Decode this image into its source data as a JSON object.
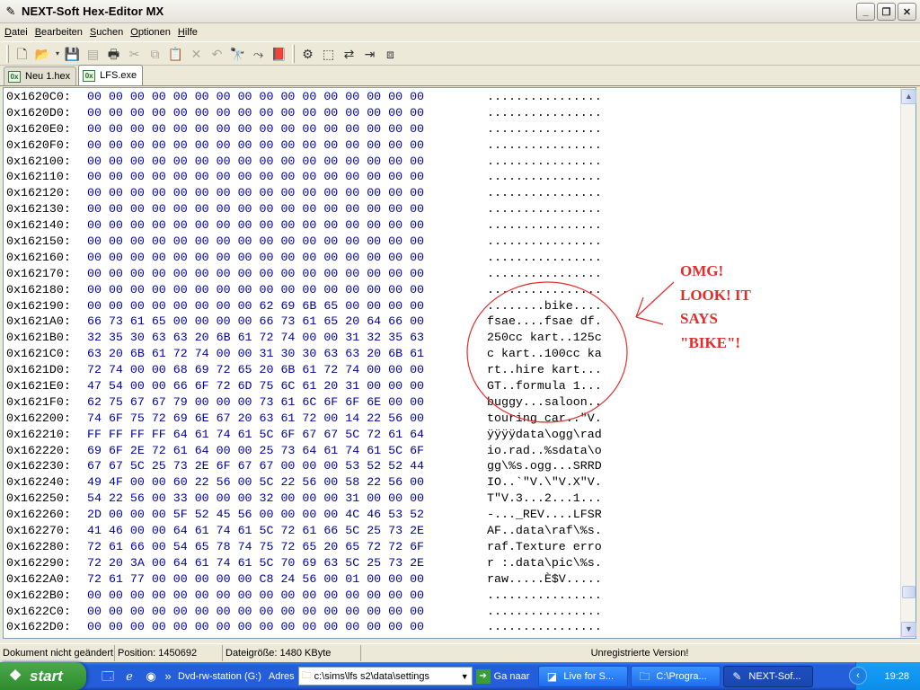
{
  "window": {
    "title": "NEXT-Soft Hex-Editor MX",
    "min_icon": "minimize-icon",
    "max_icon": "restore-icon",
    "close_icon": "close-icon"
  },
  "menu": [
    {
      "label": "Datei",
      "key": "D",
      "rest": "atei"
    },
    {
      "label": "Bearbeiten",
      "key": "B",
      "rest": "earbeiten"
    },
    {
      "label": "Suchen",
      "key": "S",
      "rest": "uchen"
    },
    {
      "label": "Optionen",
      "key": "O",
      "rest": "ptionen"
    },
    {
      "label": "Hilfe",
      "key": "H",
      "rest": "ilfe"
    }
  ],
  "toolbar": {
    "icons": [
      "new-file-icon",
      "open-folder-icon",
      "dropdown-arrow-icon",
      "save-icon",
      "save-all-icon",
      "print-icon",
      "cut-icon",
      "copy-icon",
      "paste-icon",
      "delete-icon",
      "undo-icon",
      "find-icon",
      "find-next-icon",
      "book-icon",
      "settings-icon",
      "select-icon",
      "replace-icon",
      "goto-icon",
      "compare-icon"
    ]
  },
  "tabs": [
    {
      "label": "Neu 1.hex",
      "active": false
    },
    {
      "label": "LFS.exe",
      "active": true
    }
  ],
  "rows": [
    {
      "addr": "0x1620C0:",
      "hex": "00 00 00 00 00 00 00 00 00 00 00 00 00 00 00 00",
      "ascii": "................"
    },
    {
      "addr": "0x1620D0:",
      "hex": "00 00 00 00 00 00 00 00 00 00 00 00 00 00 00 00",
      "ascii": "................"
    },
    {
      "addr": "0x1620E0:",
      "hex": "00 00 00 00 00 00 00 00 00 00 00 00 00 00 00 00",
      "ascii": "................"
    },
    {
      "addr": "0x1620F0:",
      "hex": "00 00 00 00 00 00 00 00 00 00 00 00 00 00 00 00",
      "ascii": "................"
    },
    {
      "addr": "0x162100:",
      "hex": "00 00 00 00 00 00 00 00 00 00 00 00 00 00 00 00",
      "ascii": "................"
    },
    {
      "addr": "0x162110:",
      "hex": "00 00 00 00 00 00 00 00 00 00 00 00 00 00 00 00",
      "ascii": "................"
    },
    {
      "addr": "0x162120:",
      "hex": "00 00 00 00 00 00 00 00 00 00 00 00 00 00 00 00",
      "ascii": "................"
    },
    {
      "addr": "0x162130:",
      "hex": "00 00 00 00 00 00 00 00 00 00 00 00 00 00 00 00",
      "ascii": "................"
    },
    {
      "addr": "0x162140:",
      "hex": "00 00 00 00 00 00 00 00 00 00 00 00 00 00 00 00",
      "ascii": "................"
    },
    {
      "addr": "0x162150:",
      "hex": "00 00 00 00 00 00 00 00 00 00 00 00 00 00 00 00",
      "ascii": "................"
    },
    {
      "addr": "0x162160:",
      "hex": "00 00 00 00 00 00 00 00 00 00 00 00 00 00 00 00",
      "ascii": "................"
    },
    {
      "addr": "0x162170:",
      "hex": "00 00 00 00 00 00 00 00 00 00 00 00 00 00 00 00",
      "ascii": "................"
    },
    {
      "addr": "0x162180:",
      "hex": "00 00 00 00 00 00 00 00 00 00 00 00 00 00 00 00",
      "ascii": "................"
    },
    {
      "addr": "0x162190:",
      "hex": "00 00 00 00 00 00 00 00 62 69 6B 65 00 00 00 00",
      "ascii": "........bike...."
    },
    {
      "addr": "0x1621A0:",
      "hex": "66 73 61 65 00 00 00 00 66 73 61 65 20 64 66 00",
      "ascii": "fsae....fsae df."
    },
    {
      "addr": "0x1621B0:",
      "hex": "32 35 30 63 63 20 6B 61 72 74 00 00 31 32 35 63",
      "ascii": "250cc kart..125c"
    },
    {
      "addr": "0x1621C0:",
      "hex": "63 20 6B 61 72 74 00 00 31 30 30 63 63 20 6B 61",
      "ascii": "c kart..100cc ka"
    },
    {
      "addr": "0x1621D0:",
      "hex": "72 74 00 00 68 69 72 65 20 6B 61 72 74 00 00 00",
      "ascii": "rt..hire kart..."
    },
    {
      "addr": "0x1621E0:",
      "hex": "47 54 00 00 66 6F 72 6D 75 6C 61 20 31 00 00 00",
      "ascii": "GT..formula 1..."
    },
    {
      "addr": "0x1621F0:",
      "hex": "62 75 67 67 79 00 00 00 73 61 6C 6F 6F 6E 00 00",
      "ascii": "buggy...saloon.."
    },
    {
      "addr": "0x162200:",
      "hex": "74 6F 75 72 69 6E 67 20 63 61 72 00 14 22 56 00",
      "ascii": "touring car..\"V."
    },
    {
      "addr": "0x162210:",
      "hex": "FF FF FF FF 64 61 74 61 5C 6F 67 67 5C 72 61 64",
      "ascii": "ÿÿÿÿdata\\ogg\\rad"
    },
    {
      "addr": "0x162220:",
      "hex": "69 6F 2E 72 61 64 00 00 25 73 64 61 74 61 5C 6F",
      "ascii": "io.rad..%sdata\\o"
    },
    {
      "addr": "0x162230:",
      "hex": "67 67 5C 25 73 2E 6F 67 67 00 00 00 53 52 52 44",
      "ascii": "gg\\%s.ogg...SRRD"
    },
    {
      "addr": "0x162240:",
      "hex": "49 4F 00 00 60 22 56 00 5C 22 56 00 58 22 56 00",
      "ascii": "IO..`\"V.\\\"V.X\"V."
    },
    {
      "addr": "0x162250:",
      "hex": "54 22 56 00 33 00 00 00 32 00 00 00 31 00 00 00",
      "ascii": "T\"V.3...2...1..."
    },
    {
      "addr": "0x162260:",
      "hex": "2D 00 00 00 5F 52 45 56 00 00 00 00 4C 46 53 52",
      "ascii": "-..._REV....LFSR"
    },
    {
      "addr": "0x162270:",
      "hex": "41 46 00 00 64 61 74 61 5C 72 61 66 5C 25 73 2E",
      "ascii": "AF..data\\raf\\%s."
    },
    {
      "addr": "0x162280:",
      "hex": "72 61 66 00 54 65 78 74 75 72 65 20 65 72 72 6F",
      "ascii": "raf.Texture erro"
    },
    {
      "addr": "0x162290:",
      "hex": "72 20 3A 00 64 61 74 61 5C 70 69 63 5C 25 73 2E",
      "ascii": "r :.data\\pic\\%s."
    },
    {
      "addr": "0x1622A0:",
      "hex": "72 61 77 00 00 00 00 00 C8 24 56 00 01 00 00 00",
      "ascii": "raw.....È$V....."
    },
    {
      "addr": "0x1622B0:",
      "hex": "00 00 00 00 00 00 00 00 00 00 00 00 00 00 00 00",
      "ascii": "................"
    },
    {
      "addr": "0x1622C0:",
      "hex": "00 00 00 00 00 00 00 00 00 00 00 00 00 00 00 00",
      "ascii": "................"
    },
    {
      "addr": "0x1622D0:",
      "hex": "00 00 00 00 00 00 00 00 00 00 00 00 00 00 00 00",
      "ascii": "................"
    }
  ],
  "annotation": {
    "lines": [
      "OMG!",
      "LOOK! IT",
      "SAYS",
      "\"BIKE\"!"
    ],
    "color": "#e32d2d"
  },
  "status": {
    "doc_state": "Dokument nicht geändert",
    "position": "Position: 1450692",
    "filesize": "Dateigröße: 1480 KByte",
    "version": "Unregistrierte Version!"
  },
  "taskbar": {
    "start_label": "start",
    "drive_label": "Dvd-rw-station (G:)",
    "address_label": "Adres",
    "address_value": "c:\\sims\\lfs s2\\data\\settings",
    "go_label": "Ga naar",
    "tasks": [
      {
        "label": "Live for S...",
        "icon": "lfs-app-icon",
        "active": false
      },
      {
        "label": "C:\\Progra...",
        "icon": "folder-icon",
        "active": false
      },
      {
        "label": "NEXT-Sof...",
        "icon": "hex-editor-icon",
        "active": true
      }
    ],
    "clock": "19:28"
  },
  "colors": {
    "hex_text": "#0000a0",
    "taskbar": "#245edb",
    "start": "#3c9a3c",
    "annotation": "#e32d2d"
  }
}
